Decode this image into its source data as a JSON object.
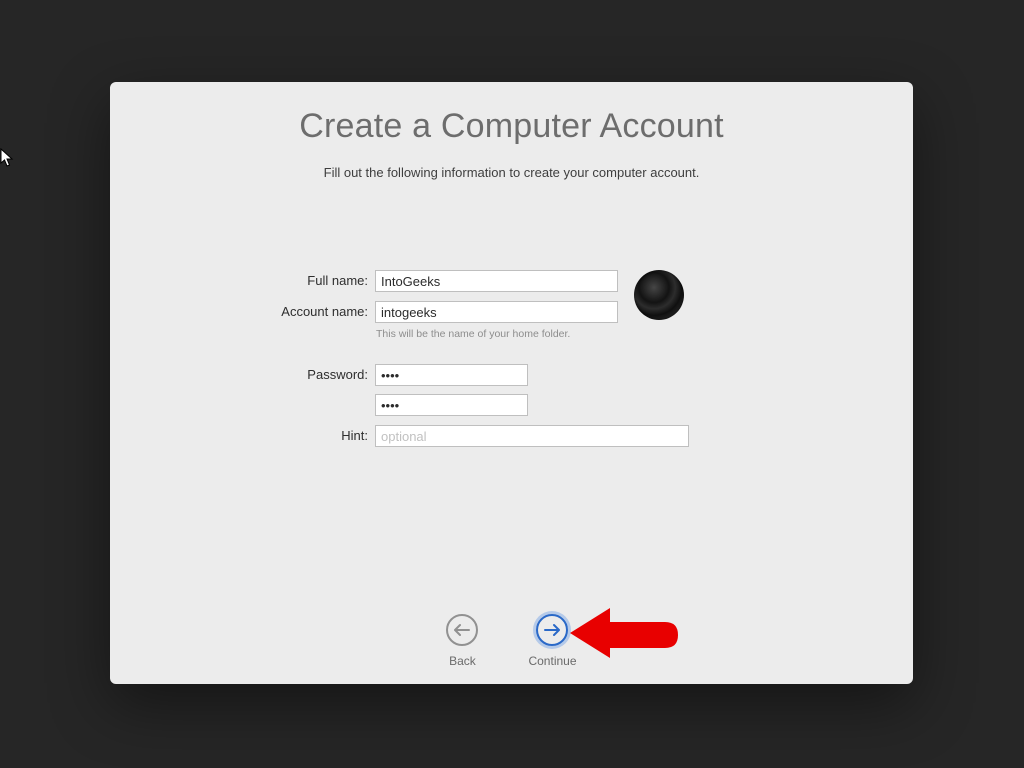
{
  "title": "Create a Computer Account",
  "subtitle": "Fill out the following information to create your computer account.",
  "form": {
    "full_name_label": "Full name:",
    "full_name_value": "IntoGeeks",
    "account_name_label": "Account name:",
    "account_name_value": "intogeeks",
    "account_name_hint": "This will be the name of your home folder.",
    "password_label": "Password:",
    "password_value": "••••",
    "password_verify_value": "••••",
    "hint_label": "Hint:",
    "hint_placeholder": "optional",
    "hint_value": ""
  },
  "nav": {
    "back": "Back",
    "continue": "Continue"
  }
}
